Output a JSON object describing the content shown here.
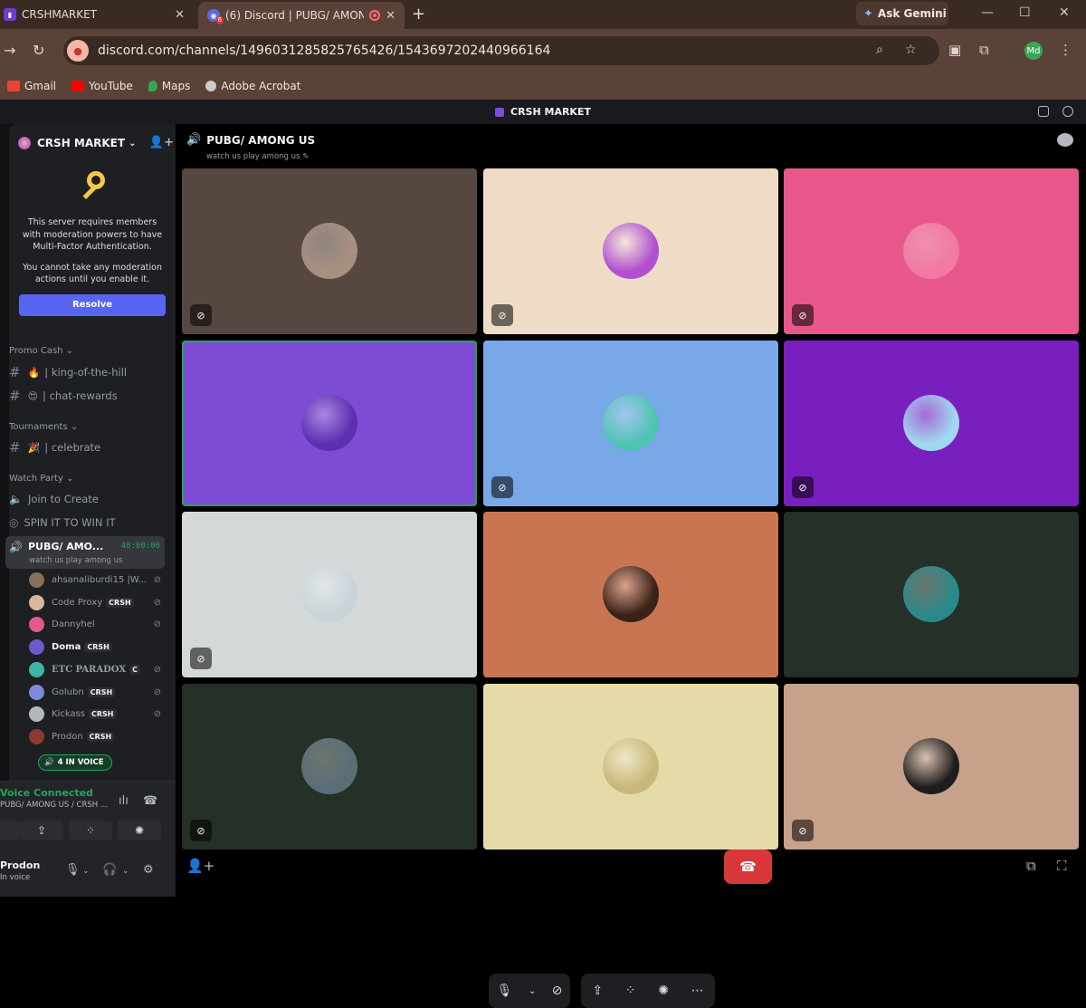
{
  "browser": {
    "tabs": [
      {
        "title": "CRSHMARKET"
      },
      {
        "title": "(6) Discord | PUBG/ AMONG US"
      }
    ],
    "ask_gemini": "Ask Gemini",
    "url": "discord.com/channels/1496031285825765426/1543697202440966164",
    "profile_initials": "Md",
    "bookmarks": [
      "Gmail",
      "YouTube",
      "Maps",
      "Adobe Acrobat"
    ]
  },
  "app_title": "CRSH MARKET",
  "sidebar": {
    "server_name": "CRSH MARKET",
    "mfa_notice": {
      "line1": "This server requires members with moderation powers to have Multi-Factor Authentication.",
      "line2": "You cannot take any moderation actions until you enable it.",
      "button": "Resolve"
    },
    "categories": [
      {
        "name": "Promo Cash"
      },
      {
        "name": "Tournaments"
      },
      {
        "name": "Watch Party"
      }
    ],
    "channels": [
      {
        "name": "king-of-the-hill",
        "emoji": "🔥"
      },
      {
        "name": "chat-rewards",
        "emoji": "😍"
      },
      {
        "name": "celebrate",
        "emoji": "🎉"
      },
      {
        "name": "Join to Create"
      },
      {
        "name": "SPIN IT TO WIN IT"
      }
    ],
    "active_voice": {
      "name": "PUBG/ AMO...",
      "timer": "48:00:00",
      "topic": "watch us play among us"
    },
    "members": [
      {
        "name": "ahsanaliburdi15 |W...",
        "tag": "",
        "color": "#8a6e5c"
      },
      {
        "name": "Code Proxy",
        "tag": "CRSH",
        "color": "#d9b89a"
      },
      {
        "name": "Dannyhel",
        "tag": "",
        "color": "#e05a8a"
      },
      {
        "name": "Doma",
        "tag": "CRSH",
        "color": "#6a5acd"
      },
      {
        "name": "ETC PARADOX",
        "tag": "C",
        "color": "#3fb5a5"
      },
      {
        "name": "Golubn",
        "tag": "CRSH",
        "color": "#7d8ad9"
      },
      {
        "name": "Kickass",
        "tag": "CRSH",
        "color": "#b0b8bd"
      },
      {
        "name": "Prodon",
        "tag": "CRSH",
        "color": "#8b3a2e"
      }
    ],
    "in_voice": "4 IN VOICE",
    "voice_panel": {
      "status": "Voice Connected",
      "location": "PUBG/ AMONG US / CRSH ..."
    },
    "user": {
      "name": "Prodon",
      "status": "In voice"
    }
  },
  "main": {
    "channel_name": "PUBG/ AMONG US",
    "channel_topic": "watch us play among us",
    "tiles": [
      {
        "bg": "#574741",
        "avatar": "#a89080",
        "mic": "muted"
      },
      {
        "bg": "#efdcc6",
        "avatar": "#b04fd0",
        "mic": "muted"
      },
      {
        "bg": "#e8578b",
        "avatar": "#f07aa2",
        "mic": "muted"
      },
      {
        "bg": "#7d4bd4",
        "avatar": "#5b2fb0",
        "mic": "",
        "speaking": true
      },
      {
        "bg": "#78a8e8",
        "avatar": "#4fc3b5",
        "mic": "muted"
      },
      {
        "bg": "#7a1fbf",
        "avatar": "#9fd8f0",
        "mic": "deafened"
      },
      {
        "bg": "#d4d8d9",
        "avatar": "#c8d4da",
        "mic": "deafened"
      },
      {
        "bg": "#c97552",
        "avatar": "#3a2218",
        "mic": ""
      },
      {
        "bg": "#243028",
        "avatar": "#2a8a8a",
        "mic": ""
      },
      {
        "bg": "#253027",
        "avatar": "#5a6e76",
        "mic": "muted"
      },
      {
        "bg": "#e4dba8",
        "avatar": "#c8b87a",
        "mic": ""
      },
      {
        "bg": "#c7a18a",
        "avatar": "#1e1e1e",
        "mic": "muted"
      }
    ]
  }
}
